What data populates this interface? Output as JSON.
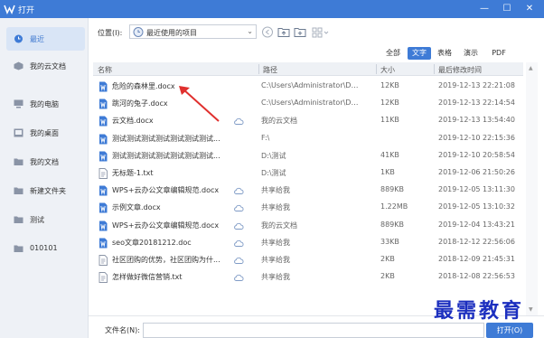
{
  "window": {
    "title": "打开",
    "minimize_glyph": "—",
    "maximize_glyph": "☐",
    "close_glyph": "✕"
  },
  "sidebar": {
    "items": [
      {
        "label": "最近",
        "icon": "clock-icon",
        "active": true
      },
      {
        "label": "我的云文档",
        "icon": "cloud-doc-icon"
      },
      {
        "label": "我的电脑",
        "icon": "computer-icon"
      },
      {
        "label": "我的桌面",
        "icon": "desktop-icon"
      },
      {
        "label": "我的文档",
        "icon": "folder-icon"
      },
      {
        "label": "新建文件夹",
        "icon": "folder-icon"
      },
      {
        "label": "测试",
        "icon": "folder-icon"
      },
      {
        "label": "010101",
        "icon": "folder-icon"
      }
    ]
  },
  "location": {
    "label": "位置(I):",
    "value": "最近使用的项目",
    "caret": "⌄"
  },
  "filters": {
    "items": [
      "全部",
      "文字",
      "表格",
      "演示",
      "PDF"
    ],
    "active": "文字"
  },
  "columns": {
    "name": "名称",
    "path": "路径",
    "size": "大小",
    "modified": "最后修改时间"
  },
  "files": [
    {
      "name": "危险的森林里.docx",
      "path": "C:\\Users\\Administrator\\Deskto...",
      "size": "12KB",
      "date": "2019-12-13 22:21:08",
      "type": "word",
      "cloud": false
    },
    {
      "name": "跳河的兔子.docx",
      "path": "C:\\Users\\Administrator\\Deskto...",
      "size": "12KB",
      "date": "2019-12-13 22:14:54",
      "type": "word",
      "cloud": false
    },
    {
      "name": "云文档.docx",
      "path": "我的云文档",
      "size": "11KB",
      "date": "2019-12-13 13:54:40",
      "type": "word",
      "cloud": true
    },
    {
      "name": "测试测试测试测试测试测试测试...",
      "path": "F:\\",
      "size": "",
      "date": "2019-12-10 22:15:36",
      "type": "word",
      "cloud": false
    },
    {
      "name": "测试测试测试测试测试测试测试...",
      "path": "D:\\测试",
      "size": "41KB",
      "date": "2019-12-10 20:58:54",
      "type": "word",
      "cloud": false
    },
    {
      "name": "无标题-1.txt",
      "path": "D:\\测试",
      "size": "1KB",
      "date": "2019-12-06 21:50:26",
      "type": "txt",
      "cloud": false
    },
    {
      "name": "WPS+云办公文章编辑规范.docx",
      "path": "共享给我",
      "size": "889KB",
      "date": "2019-12-05 13:11:30",
      "type": "word",
      "cloud": true
    },
    {
      "name": "示例文章.docx",
      "path": "共享给我",
      "size": "1.22MB",
      "date": "2019-12-05 13:10:32",
      "type": "word",
      "cloud": true
    },
    {
      "name": "WPS+云办公文章编辑规范.docx",
      "path": "我的云文档",
      "size": "889KB",
      "date": "2019-12-04 13:43:21",
      "type": "word",
      "cloud": true
    },
    {
      "name": "seo文章20181212.doc",
      "path": "共享给我",
      "size": "33KB",
      "date": "2018-12-12 22:56:06",
      "type": "doc",
      "cloud": true
    },
    {
      "name": "社区团购的优势，社区团购为什...",
      "path": "共享给我",
      "size": "2KB",
      "date": "2018-12-09 21:45:31",
      "type": "txt",
      "cloud": true
    },
    {
      "name": "怎样做好微信营销.txt",
      "path": "共享给我",
      "size": "2KB",
      "date": "2018-12-08 22:56:53",
      "type": "txt",
      "cloud": true
    }
  ],
  "footer": {
    "filename_label": "文件名(N):",
    "filename_value": "",
    "open_label": "打开(O)"
  },
  "watermark": "最需教育",
  "colors": {
    "accent": "#3e7bd6",
    "annotation_arrow": "#e0302e",
    "watermark": "#1c2fbf"
  }
}
